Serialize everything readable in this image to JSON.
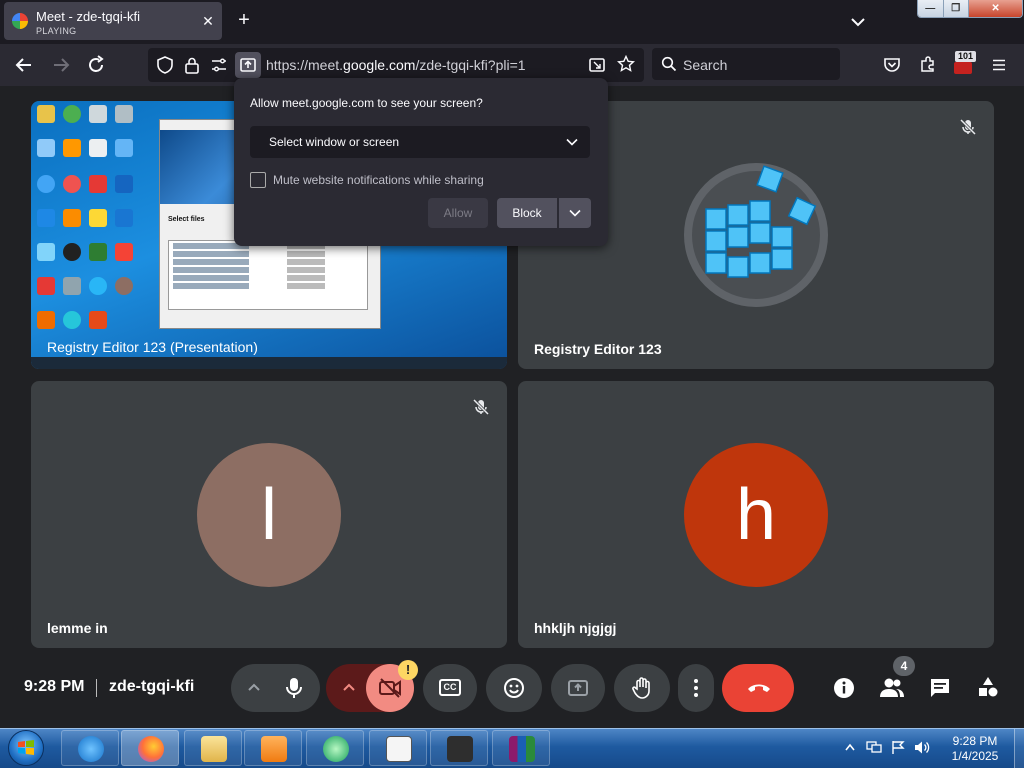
{
  "browser": {
    "tab": {
      "title": "Meet - zde-tgqi-kfi",
      "status": "PLAYING"
    },
    "url": {
      "prefix": "https://meet.",
      "host": "google.com",
      "path": "/zde-tgqi-kfi?pli=1"
    },
    "search_placeholder": "Search",
    "extension_badge": "101"
  },
  "popup": {
    "title": "Allow meet.google.com to see your screen?",
    "select_label": "Select window or screen",
    "checkbox_label": "Mute website notifications while sharing",
    "allow_label": "Allow",
    "block_label": "Block"
  },
  "tiles": [
    {
      "name": "Registry Editor 123 (Presentation)"
    },
    {
      "name": "Registry Editor 123"
    },
    {
      "name": "lemme in",
      "initial": "l",
      "color": "#8d6e63"
    },
    {
      "name": "hhkljh njgjgj",
      "initial": "h",
      "color": "#bf360c"
    }
  ],
  "presentation": {
    "dialog_heading": "Select files"
  },
  "meet_bar": {
    "time": "9:28 PM",
    "code": "zde-tgqi-kfi",
    "people_count": "4",
    "warning_badge": "!",
    "captions_label": "CC"
  },
  "taskbar": {
    "time": "9:28 PM",
    "date": "1/4/2025"
  },
  "colors": {
    "end_call": "#ea4335",
    "camera_off": "#f28b82",
    "camera_off_dark": "#5c1a1a",
    "accent_blue": "#4fc3f7"
  }
}
